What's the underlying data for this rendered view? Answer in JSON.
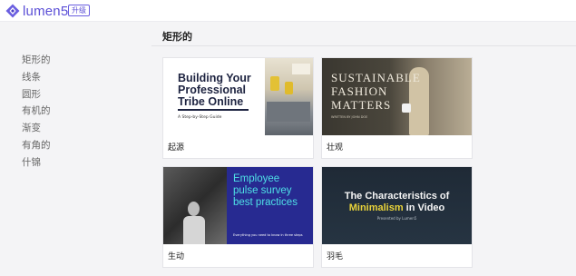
{
  "header": {
    "logo_text": "lumen5",
    "upgrade_label": "升级"
  },
  "sidebar": {
    "items": [
      "矩形的",
      "线条",
      "圆形",
      "有机的",
      "渐变",
      "有角的",
      "什锦"
    ]
  },
  "main": {
    "section_title": "矩形的",
    "cards": [
      {
        "label": "起源",
        "thumb_title": "Building Your Professional Tribe Online",
        "thumb_title_lines": [
          "Building Your",
          "Professional",
          "Tribe Online"
        ],
        "thumb_subtitle": "A Step-by-Step Guide"
      },
      {
        "label": "壮观",
        "thumb_title_lines": [
          "SUSTAINABLE",
          "FASHION",
          "MATTERS"
        ],
        "thumb_subtitle": "WRITTEN BY JOHN DOE"
      },
      {
        "label": "生动",
        "thumb_title_lines": [
          "Employee",
          "pulse survey",
          "best practices"
        ],
        "thumb_subtitle": "Everything you need to know in three steps"
      },
      {
        "label": "羽毛",
        "thumb_title_line1": "The Characteristics of",
        "thumb_title_highlight": "Minimalism",
        "thumb_title_rest": " in Video",
        "thumb_subtitle": "Presented by Lumen5"
      }
    ]
  },
  "colors": {
    "brand": "#5b4fd6",
    "background": "#f4f4f6"
  }
}
